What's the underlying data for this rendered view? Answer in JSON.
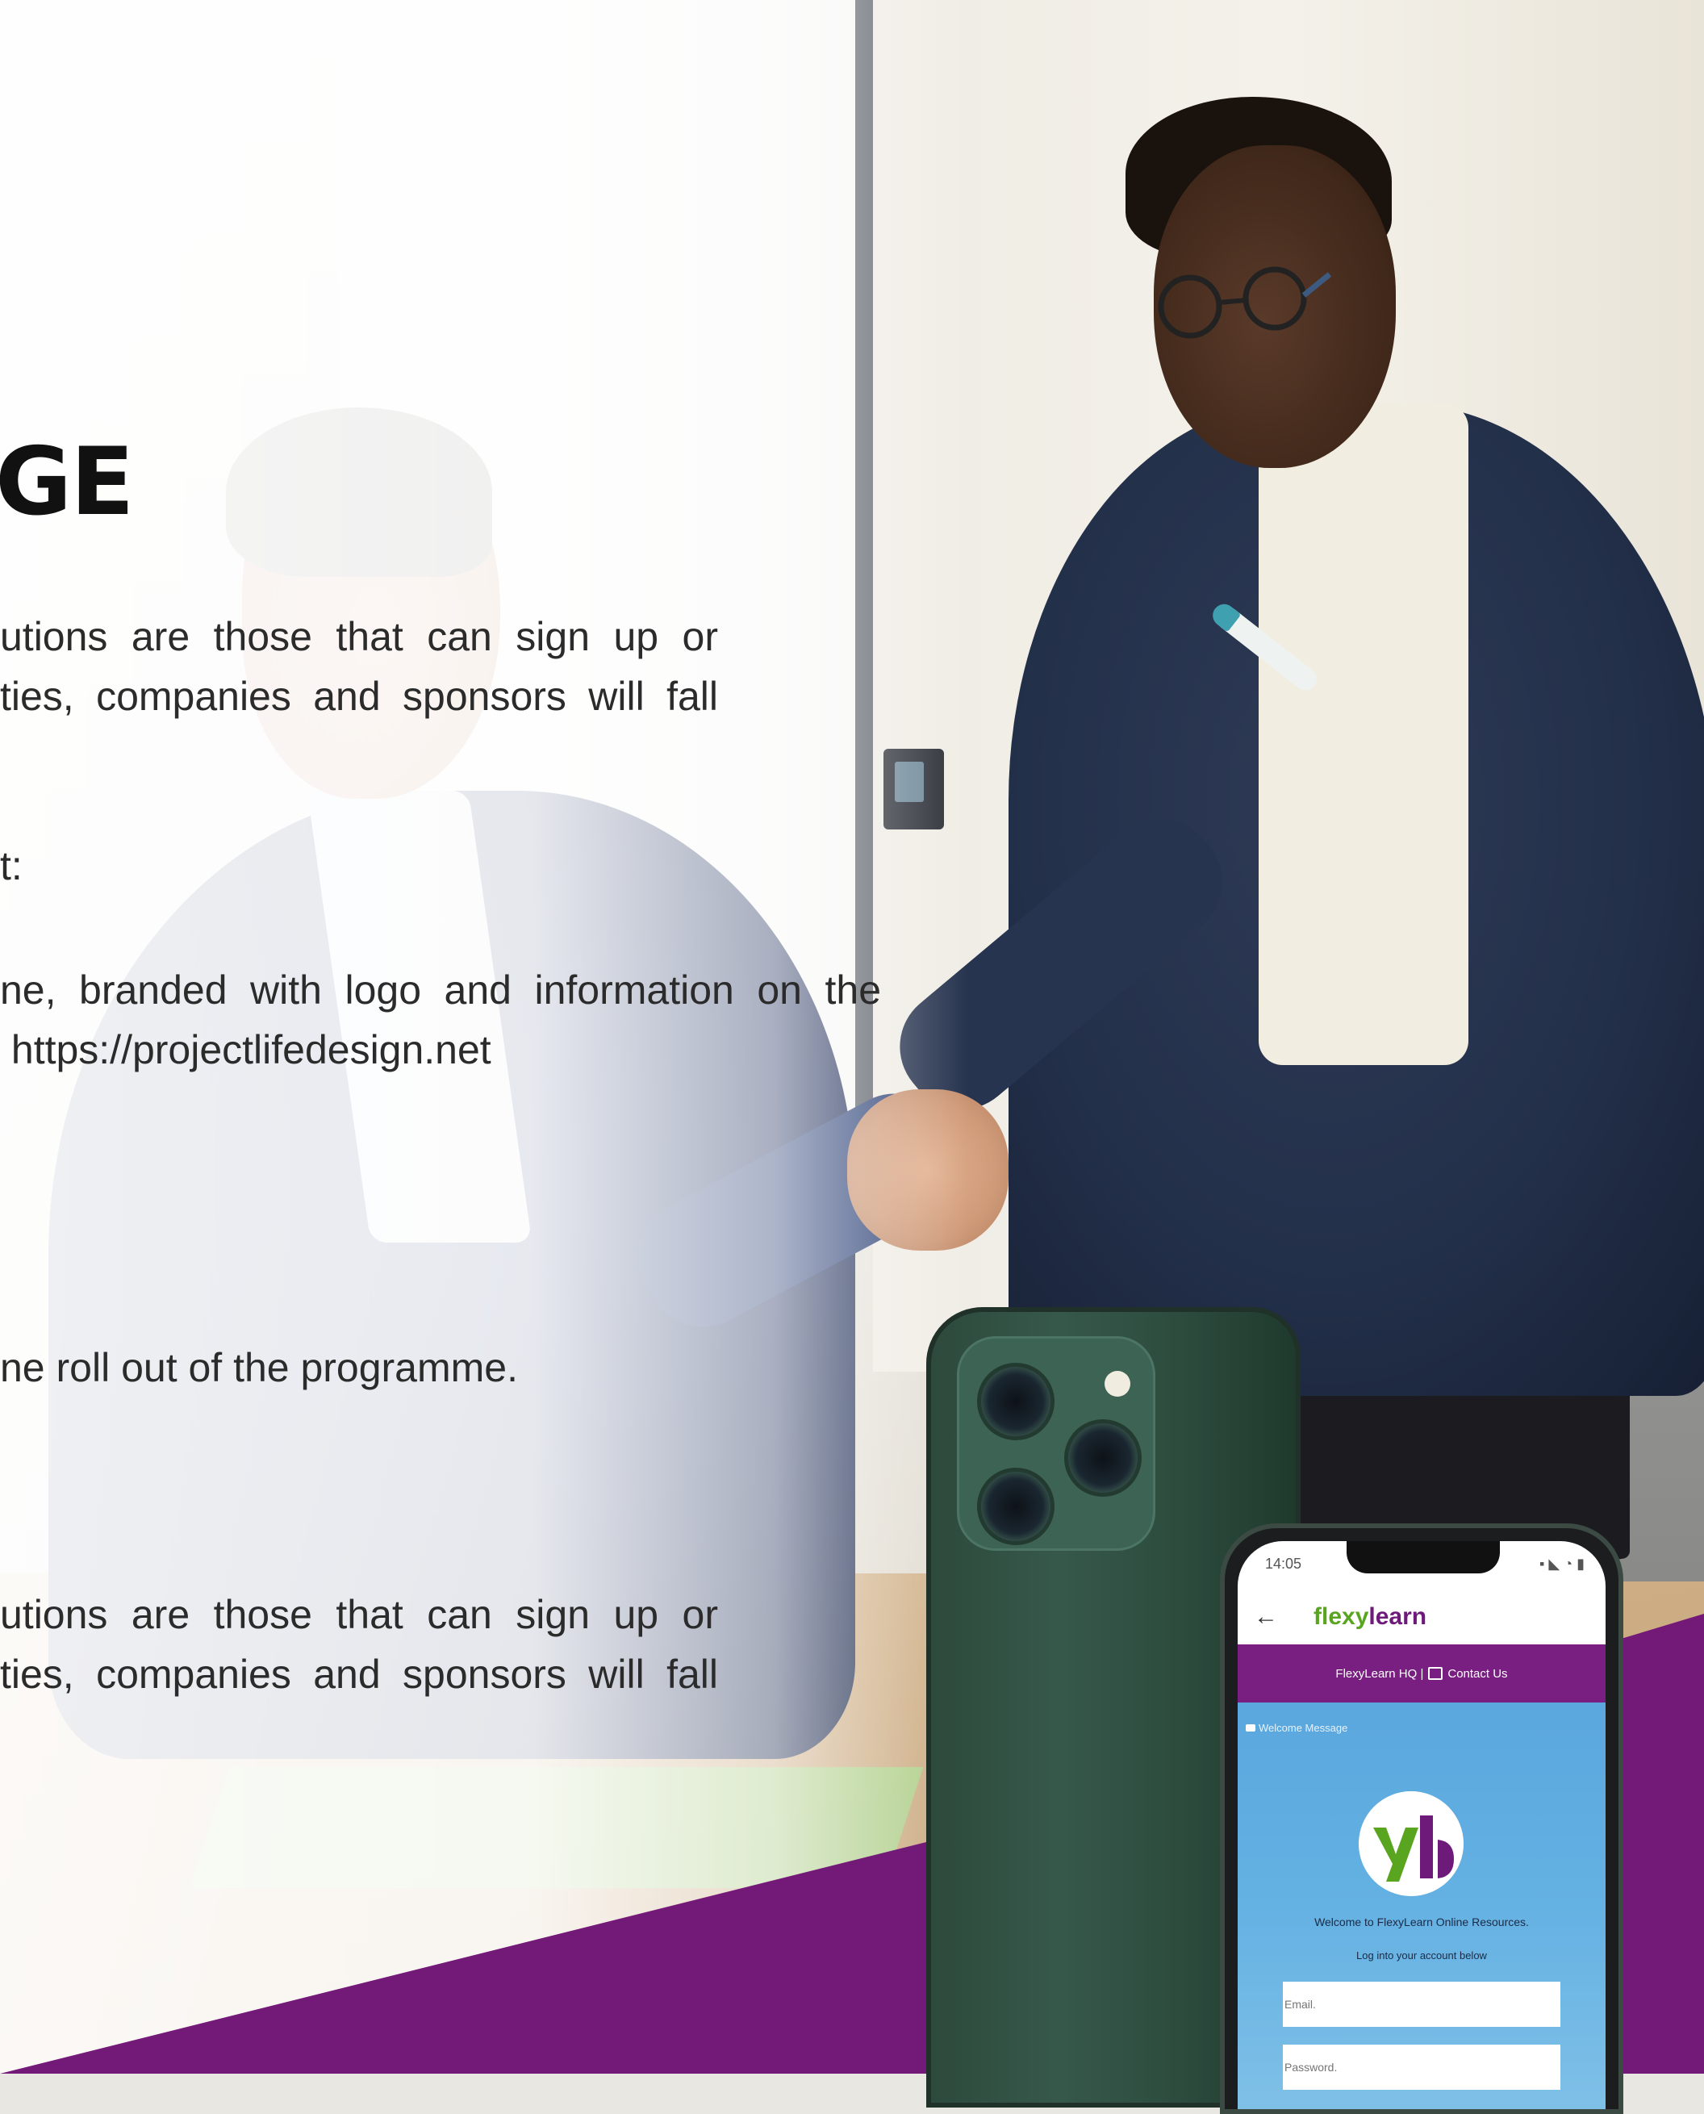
{
  "heading": "GE",
  "paragraphs": {
    "a_line1": "utions are those that can sign up or",
    "a_line2": "ties, companies and sponsors will fall",
    "b_line1": "t:",
    "c_line1": "ne, branded with logo and information on the",
    "c_line2": " https://projectlifedesign.net",
    "d_line1": "ne roll out of the programme.",
    "e_line1": "utions are those that can sign up or",
    "e_line2": "ties, companies and sponsors will fall"
  },
  "phone_app": {
    "status_time": "14:05",
    "status_icons": "▪ ◣ ◔ ▮",
    "back_glyph": "←",
    "brand_part1": "flexy",
    "brand_part2": "learn",
    "nav_hq": "FlexyLearn HQ |",
    "nav_contact": "Contact Us",
    "welcome_tag": "Welcome Message",
    "welcome_text": "Welcome to FlexyLearn Online Resources.",
    "login_prompt": "Log into your account below",
    "email_placeholder": "Email.",
    "password_placeholder": "Password."
  },
  "colors": {
    "purple": "#731a79",
    "brand_green": "#5aa520",
    "phone_green": "#36584a",
    "app_blue": "#64b1e3"
  }
}
